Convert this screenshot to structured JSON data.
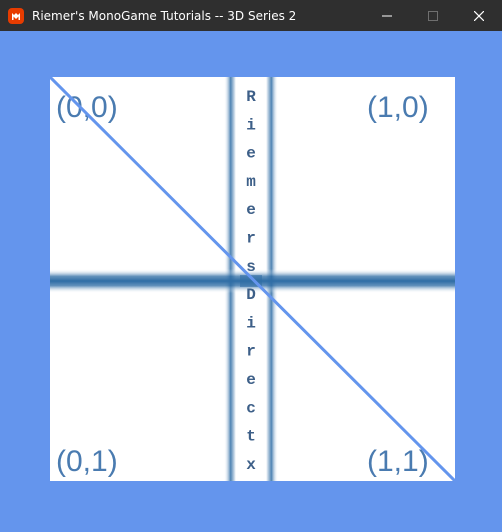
{
  "window": {
    "title": "Riemer's MonoGame Tutorials -- 3D Series 2",
    "app_icon": "monogame-icon",
    "buttons": {
      "minimize": "minimize-icon",
      "maximize": "maximize-icon",
      "close": "close-icon"
    }
  },
  "texture": {
    "corner_labels": {
      "top_left": "(0,0)",
      "top_right": "(1,0)",
      "bottom_left": "(0,1)",
      "bottom_right": "(1,1)"
    },
    "vertical_text_letters": [
      "R",
      "i",
      "e",
      "m",
      "e",
      "r",
      "s",
      "D",
      "i",
      "r",
      "e",
      "c",
      "t",
      "x"
    ]
  },
  "colors": {
    "background": "#6495ed",
    "titlebar": "#2f2f2f",
    "texture_bg": "#ffffff",
    "bar_color": "#2f6da5",
    "label_color": "#4a7bb0",
    "diagonal_line": "#6495ed"
  }
}
